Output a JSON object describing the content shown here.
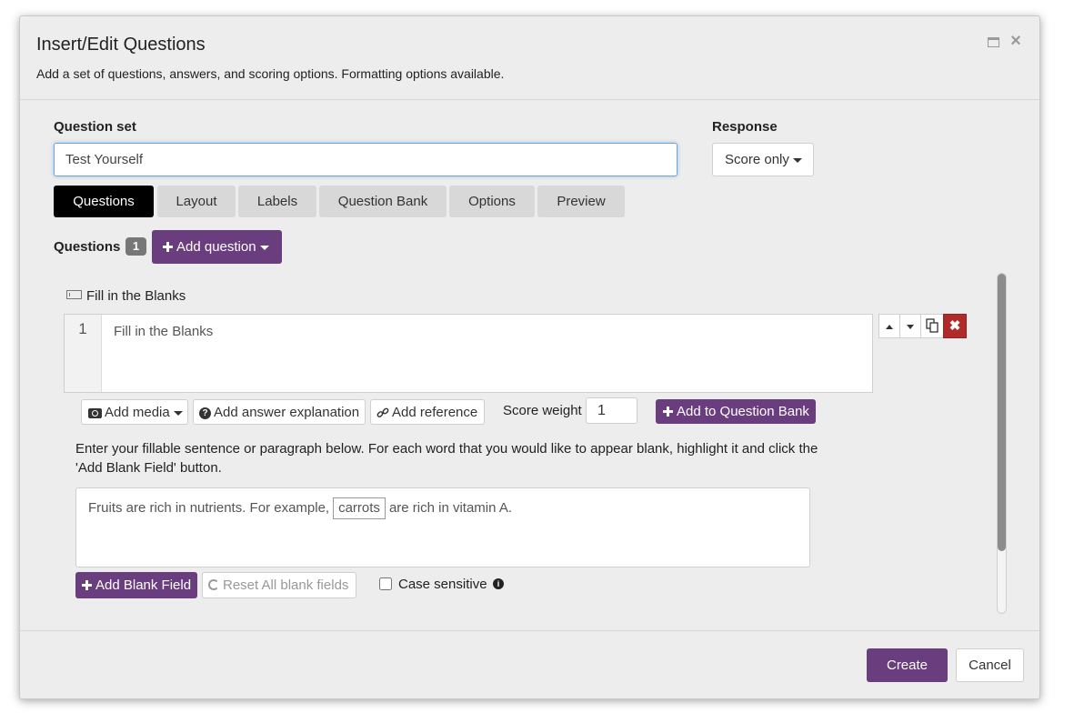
{
  "dialog": {
    "title": "Insert/Edit Questions",
    "subtitle": "Add a set of questions, answers, and scoring options. Formatting options available."
  },
  "question_set": {
    "label": "Question set",
    "value": "Test Yourself"
  },
  "response": {
    "label": "Response",
    "selected": "Score only"
  },
  "tabs": [
    {
      "label": "Questions",
      "active": true
    },
    {
      "label": "Layout",
      "active": false
    },
    {
      "label": "Labels",
      "active": false
    },
    {
      "label": "Question Bank",
      "active": false
    },
    {
      "label": "Options",
      "active": false
    },
    {
      "label": "Preview",
      "active": false
    }
  ],
  "questions": {
    "label": "Questions",
    "count": "1",
    "add_label": "Add question"
  },
  "question_item": {
    "type_label": "Fill in the Blanks",
    "number": "1",
    "text": "Fill in the Blanks",
    "add_media": "Add media",
    "add_explanation": "Add answer explanation",
    "add_reference": "Add reference",
    "score_weight_label": "Score weight",
    "score_weight_value": "1",
    "add_to_bank": "Add to Question Bank"
  },
  "fill_blanks": {
    "instructions": "Enter your fillable sentence or paragraph below. For each word that you would like to appear blank, highlight it and click the 'Add Blank Field' button.",
    "sentence_before": "Fruits are rich in nutrients. For example,",
    "blank_word": "carrots",
    "sentence_after": "are rich in vitamin A.",
    "add_blank_label": "Add Blank Field",
    "reset_label": "Reset All blank fields",
    "case_sensitive_label": "Case sensitive",
    "case_sensitive_checked": false
  },
  "footer": {
    "create_label": "Create",
    "cancel_label": "Cancel"
  },
  "colors": {
    "accent_purple": "#6a3e7e",
    "delete_red": "#b02a2a",
    "active_tab": "#000000"
  }
}
